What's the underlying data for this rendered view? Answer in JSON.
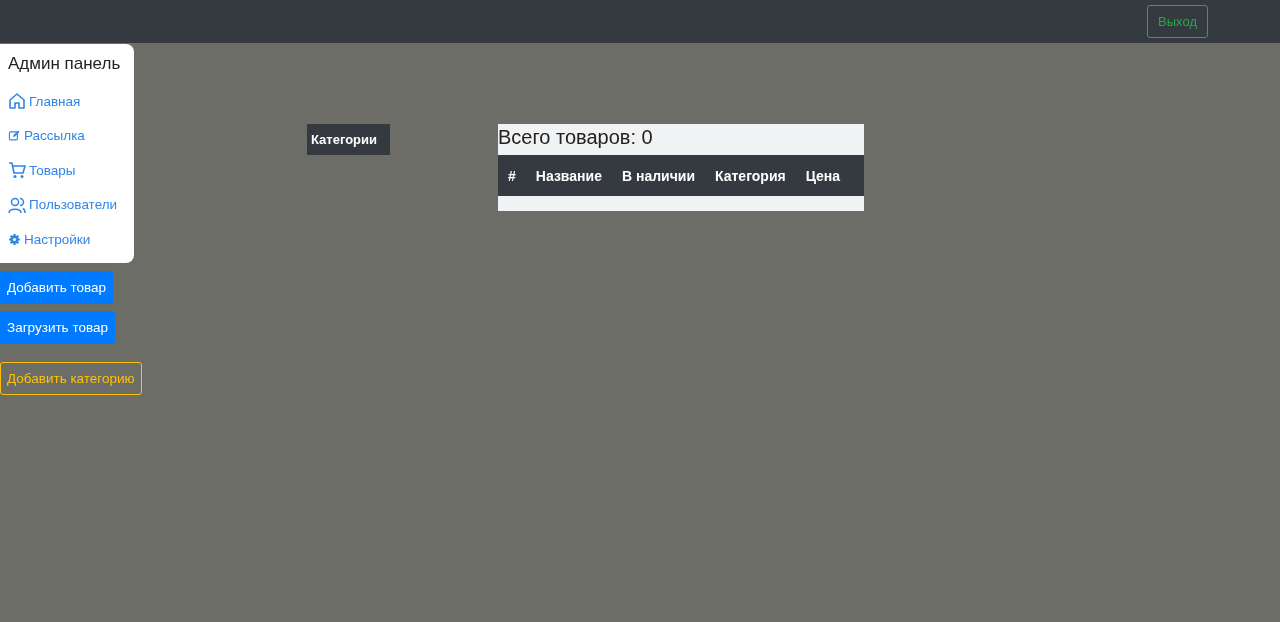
{
  "navbar": {
    "logout_button": "Выход"
  },
  "sidebar": {
    "title": "Админ панель",
    "items": [
      {
        "label": "Главная",
        "kind": "home"
      },
      {
        "label": "Рассылка",
        "kind": "edit"
      },
      {
        "label": "Товары",
        "kind": "cart"
      },
      {
        "label": "Пользователи",
        "kind": "users"
      },
      {
        "label": "Настройки",
        "kind": "settings"
      }
    ]
  },
  "actions": [
    {
      "label": "Добавить товар",
      "kind": "primary"
    },
    {
      "label": "Загрузить товар",
      "kind": "primary"
    },
    {
      "label": "Добавить категорию",
      "kind": "outline-warning"
    }
  ],
  "categories": {
    "title": "Категории"
  },
  "products": {
    "total": "Всего товаров: 0",
    "table": {
      "columns": [
        "#",
        "Название",
        "В наличии",
        "Категория",
        "Цена"
      ]
    }
  }
}
